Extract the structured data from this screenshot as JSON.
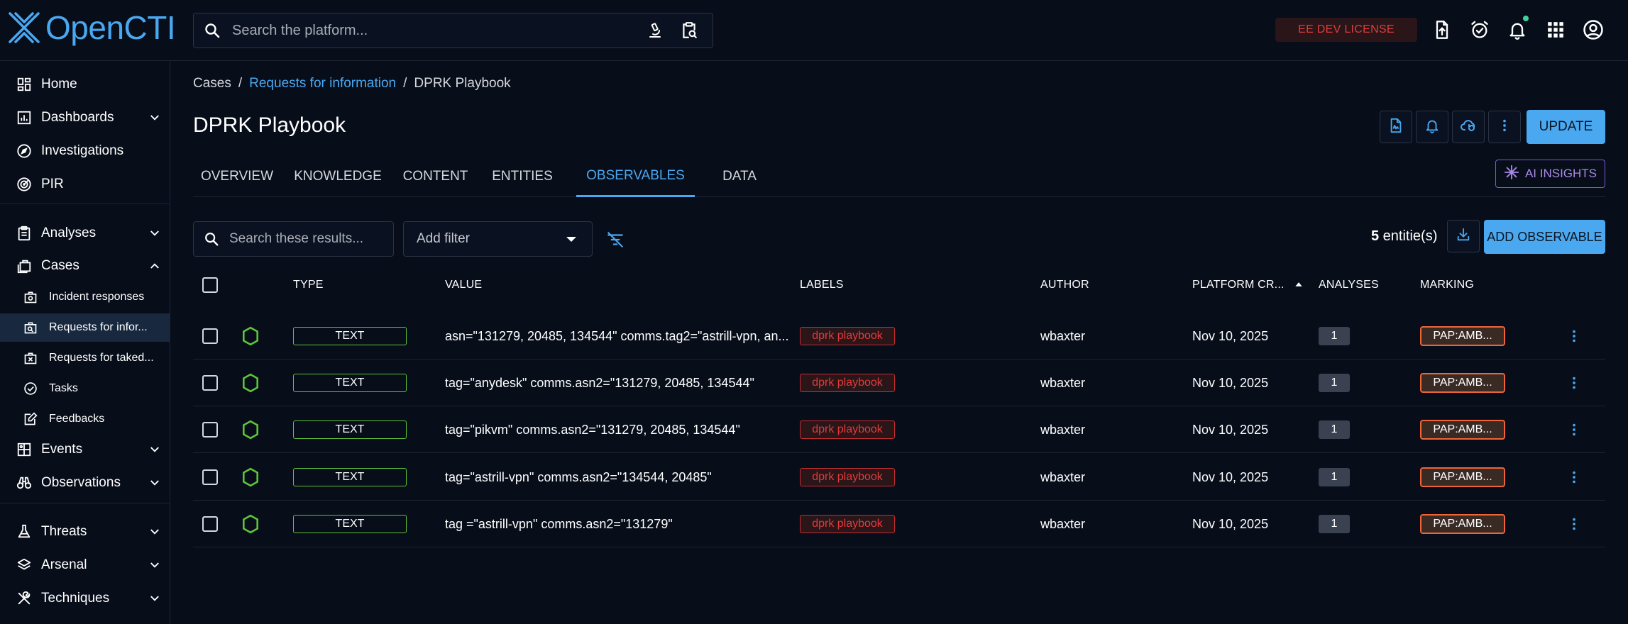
{
  "app": {
    "logo_text": "OpenCTI",
    "search_placeholder": "Search the platform...",
    "license_badge": "EE DEV LICENSE"
  },
  "sidebar": {
    "items": [
      {
        "label": "Home",
        "icon": "home-dashboard-icon"
      },
      {
        "label": "Dashboards",
        "icon": "chart-icon"
      },
      {
        "label": "Investigations",
        "icon": "compass-icon"
      },
      {
        "label": "PIR",
        "icon": "radar-icon"
      },
      {
        "label": "Analyses",
        "icon": "clipboard-icon"
      },
      {
        "label": "Cases",
        "icon": "briefcase-icon"
      },
      {
        "label": "Events",
        "icon": "events-icon"
      },
      {
        "label": "Observations",
        "icon": "binoculars-icon"
      },
      {
        "label": "Threats",
        "icon": "flask-icon"
      },
      {
        "label": "Arsenal",
        "icon": "layers-icon"
      },
      {
        "label": "Techniques",
        "icon": "tools-icon"
      }
    ],
    "cases_sub": [
      {
        "label": "Incident responses"
      },
      {
        "label": "Requests for infor..."
      },
      {
        "label": "Requests for taked..."
      },
      {
        "label": "Tasks"
      },
      {
        "label": "Feedbacks"
      }
    ]
  },
  "breadcrumb": {
    "root": "Cases",
    "sep1": "/",
    "link": "Requests for information",
    "sep2": "/",
    "current": "DPRK Playbook"
  },
  "page": {
    "title": "DPRK Playbook",
    "update_label": "UPDATE",
    "ai_insights_label": "AI INSIGHTS"
  },
  "tabs": [
    {
      "label": "OVERVIEW"
    },
    {
      "label": "KNOWLEDGE"
    },
    {
      "label": "CONTENT"
    },
    {
      "label": "ENTITIES"
    },
    {
      "label": "OBSERVABLES"
    },
    {
      "label": "DATA"
    }
  ],
  "toolbar": {
    "search_placeholder": "Search these results...",
    "filter_label": "Add filter",
    "count_value": "5",
    "count_suffix": " entitie(s)",
    "add_label": "ADD OBSERVABLE"
  },
  "table": {
    "columns": [
      "TYPE",
      "VALUE",
      "LABELS",
      "AUTHOR",
      "PLATFORM CR...",
      "ANALYSES",
      "MARKING"
    ],
    "rows": [
      {
        "type": "TEXT",
        "value": "asn=\"131279, 20485, 134544\" comms.tag2=\"astrill-vpn, an...",
        "label": "dprk playbook",
        "author": "wbaxter",
        "created": "Nov 10, 2025",
        "analyses": "1",
        "marking": "PAP:AMB..."
      },
      {
        "type": "TEXT",
        "value": "tag=\"anydesk\" comms.asn2=\"131279, 20485, 134544\"",
        "label": "dprk playbook",
        "author": "wbaxter",
        "created": "Nov 10, 2025",
        "analyses": "1",
        "marking": "PAP:AMB..."
      },
      {
        "type": "TEXT",
        "value": "tag=\"pikvm\" comms.asn2=\"131279, 20485, 134544\"",
        "label": "dprk playbook",
        "author": "wbaxter",
        "created": "Nov 10, 2025",
        "analyses": "1",
        "marking": "PAP:AMB..."
      },
      {
        "type": "TEXT",
        "value": "tag=\"astrill-vpn\" comms.asn2=\"134544, 20485\"",
        "label": "dprk playbook",
        "author": "wbaxter",
        "created": "Nov 10, 2025",
        "analyses": "1",
        "marking": "PAP:AMB..."
      },
      {
        "type": "TEXT",
        "value": "tag =\"astrill-vpn\" comms.asn2=\"131279\"",
        "label": "dprk playbook",
        "author": "wbaxter",
        "created": "Nov 10, 2025",
        "analyses": "1",
        "marking": "PAP:AMB..."
      }
    ]
  },
  "colors": {
    "accent": "#4aa8f0",
    "background": "#070d19",
    "label_red": "#e23b3b",
    "type_green": "#5fc43a",
    "marking_orange": "#f0643a",
    "ai_purple": "#7d5bd6"
  }
}
